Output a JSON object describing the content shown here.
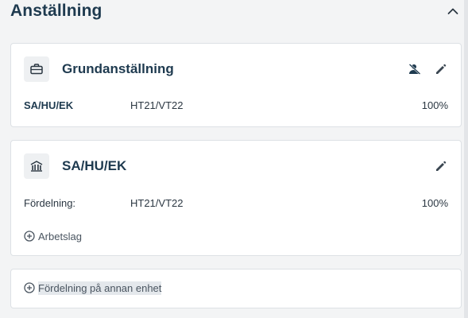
{
  "section": {
    "title": "Anställning"
  },
  "cards": {
    "employment": {
      "title": "Grundanställning",
      "row": {
        "unit": "SA/HU/EK",
        "period": "HT21/VT22",
        "percent": "100%"
      }
    },
    "unit": {
      "title": "SA/HU/EK",
      "row": {
        "label": "Fördelning:",
        "period": "HT21/VT22",
        "percent": "100%"
      },
      "add_team_label": "Arbetslag"
    },
    "other_unit": {
      "add_label": "Fördelning på annan enhet"
    }
  },
  "icons": {
    "collapse": "chevron-up-icon",
    "briefcase": "briefcase-icon",
    "building": "building-icon",
    "user_off": "user-off-icon",
    "edit": "pencil-icon",
    "add": "plus-circle-icon"
  },
  "colors": {
    "title": "#1e3a4f",
    "icon_dark": "#2b3742",
    "card_bg": "#ffffff",
    "page_bg": "#f3f4f5"
  }
}
